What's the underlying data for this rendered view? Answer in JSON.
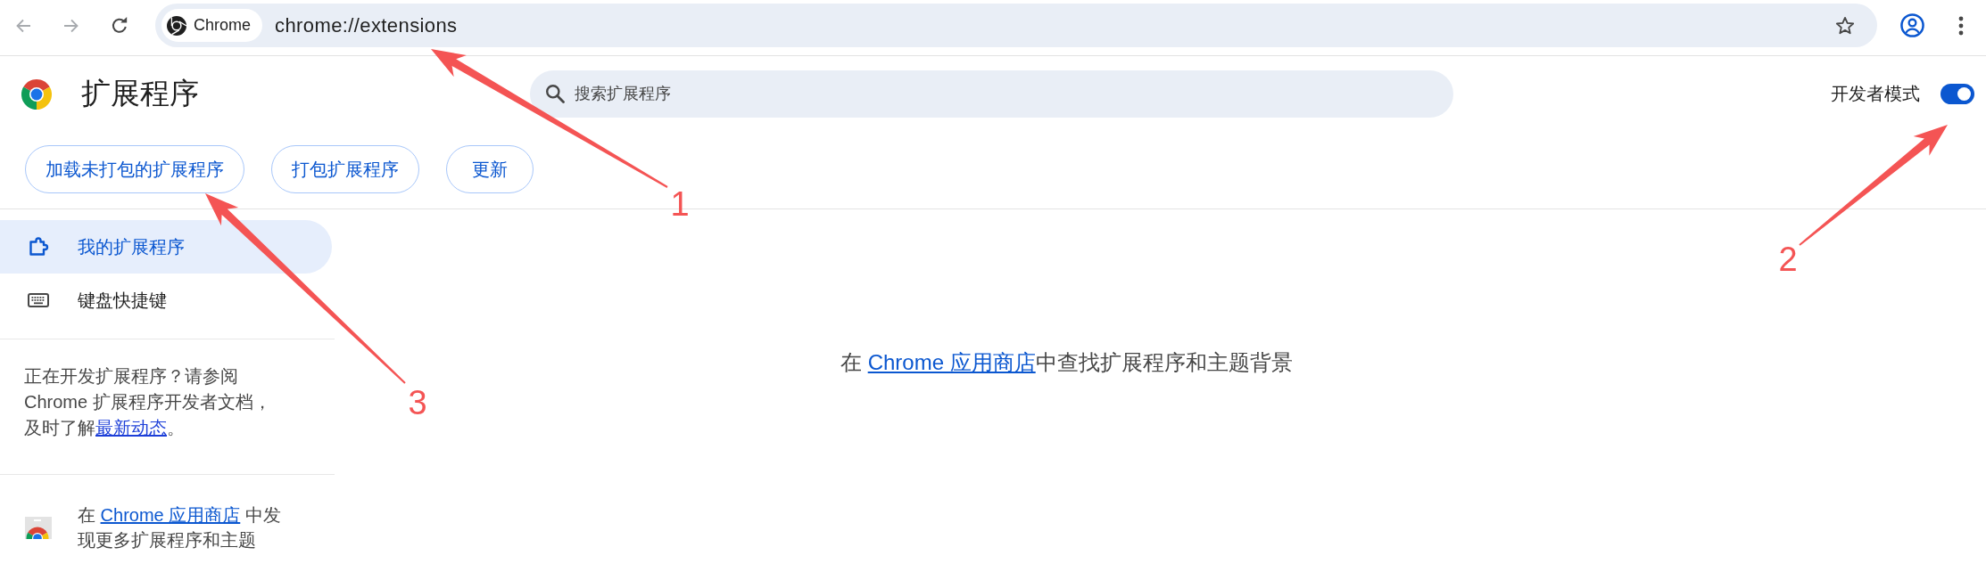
{
  "toolbar": {
    "back": {
      "disabled": true
    },
    "forward": {
      "disabled": true
    },
    "site_chip": "Chrome",
    "url": "chrome://extensions"
  },
  "header": {
    "title": "扩展程序",
    "search": {
      "placeholder": "搜索扩展程序"
    },
    "developer_mode": {
      "label": "开发者模式",
      "on": true
    },
    "buttons": [
      "加载未打包的扩展程序",
      "打包扩展程序",
      "更新"
    ]
  },
  "sidebar": {
    "items": [
      {
        "label": "我的扩展程序",
        "selected": true
      },
      {
        "label": "键盘快捷键",
        "selected": false
      }
    ],
    "developer_note": {
      "text": "正在开发扩展程序？请参阅 Chrome 扩展程序开发者文档，及时了解",
      "link": "最新动态",
      "end": "。"
    },
    "store_promo": {
      "before": "在 ",
      "link": "Chrome 应用商店",
      "after": " 中发现更多扩展程序和主题"
    }
  },
  "main": {
    "message": {
      "before": "在 ",
      "link": "Chrome 应用商店",
      "after": "中查找扩展程序和主题背景"
    }
  },
  "annotations": [
    {
      "label": "1"
    },
    {
      "label": "2"
    },
    {
      "label": "3"
    }
  ]
}
